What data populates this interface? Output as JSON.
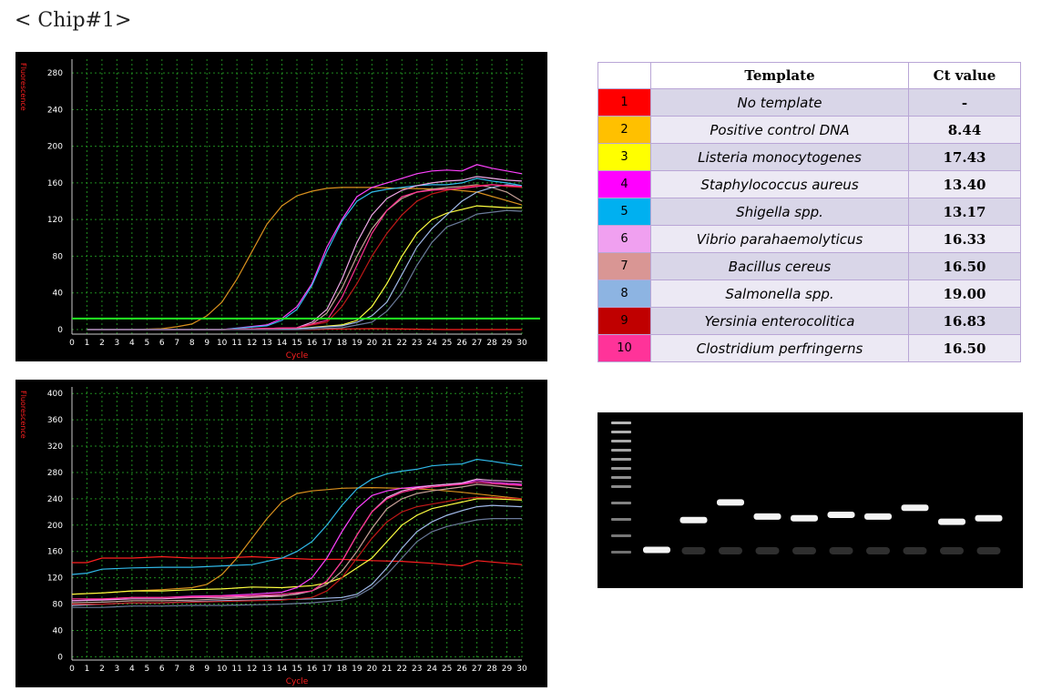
{
  "heading": "< Chip#1>",
  "chart_data": [
    {
      "type": "line",
      "ylabel": "Fluorescence",
      "xlabel": "Cycle",
      "xlim": [
        0,
        30
      ],
      "ylim": [
        -5,
        295
      ],
      "yticks": [
        0,
        40,
        80,
        120,
        160,
        200,
        240,
        280
      ],
      "xticks": [
        0,
        1,
        2,
        3,
        4,
        5,
        6,
        7,
        8,
        9,
        10,
        11,
        12,
        13,
        14,
        15,
        16,
        17,
        18,
        19,
        20,
        21,
        22,
        23,
        24,
        25,
        26,
        27,
        28,
        29,
        30
      ],
      "grid": true,
      "threshold": 12,
      "threshold_color": "#22ee22",
      "series": [
        {
          "color": "#ff2020",
          "x": [
            1,
            5,
            10,
            15,
            20,
            25,
            30
          ],
          "y": [
            0,
            0,
            0,
            0,
            1,
            0,
            0
          ]
        },
        {
          "color": "#d9901e",
          "x": [
            1,
            4,
            6,
            7,
            8,
            9,
            10,
            11,
            12,
            13,
            14,
            15,
            16,
            17,
            18,
            20,
            22,
            25,
            27,
            30
          ],
          "y": [
            0,
            0,
            1,
            3,
            6,
            15,
            30,
            55,
            85,
            115,
            135,
            146,
            151,
            154,
            155,
            155,
            154,
            153,
            150,
            136
          ]
        },
        {
          "color": "#ffff40",
          "x": [
            1,
            10,
            15,
            18,
            19,
            20,
            21,
            22,
            23,
            24,
            25,
            26,
            27,
            28,
            29,
            30
          ],
          "y": [
            0,
            0,
            1,
            5,
            10,
            25,
            50,
            80,
            105,
            120,
            127,
            131,
            135,
            134,
            133,
            133
          ]
        },
        {
          "color": "#ff40ff",
          "x": [
            1,
            10,
            13,
            14,
            15,
            16,
            17,
            18,
            19,
            20,
            21,
            22,
            23,
            24,
            25,
            26,
            27,
            28,
            29,
            30
          ],
          "y": [
            0,
            0,
            5,
            12,
            25,
            50,
            90,
            120,
            145,
            155,
            160,
            165,
            170,
            173,
            174,
            173,
            180,
            176,
            173,
            170
          ]
        },
        {
          "color": "#30b8e8",
          "x": [
            1,
            10,
            13,
            14,
            15,
            16,
            17,
            18,
            19,
            20,
            21,
            22,
            23,
            24,
            25,
            26,
            27,
            28,
            29,
            30
          ],
          "y": [
            0,
            0,
            4,
            10,
            22,
            48,
            85,
            118,
            140,
            150,
            153,
            155,
            157,
            158,
            158,
            160,
            165,
            162,
            160,
            157
          ]
        },
        {
          "color": "#f0a8e8",
          "x": [
            1,
            10,
            15,
            16,
            17,
            18,
            19,
            20,
            21,
            22,
            23,
            24,
            25,
            26,
            27,
            28,
            29,
            30
          ],
          "y": [
            0,
            0,
            2,
            8,
            22,
            55,
            95,
            125,
            143,
            152,
            157,
            160,
            162,
            163,
            167,
            165,
            163,
            162
          ]
        },
        {
          "color": "#c8a098",
          "x": [
            1,
            10,
            15,
            16,
            17,
            18,
            19,
            20,
            21,
            22,
            23,
            24,
            25,
            26,
            27,
            28,
            29,
            30
          ],
          "y": [
            0,
            0,
            2,
            6,
            18,
            45,
            80,
            110,
            130,
            143,
            150,
            153,
            155,
            156,
            158,
            155,
            150,
            140
          ]
        },
        {
          "color": "#a0b8e8",
          "x": [
            1,
            10,
            15,
            18,
            19,
            20,
            21,
            22,
            23,
            24,
            25,
            26,
            27,
            28,
            29,
            30
          ],
          "y": [
            0,
            0,
            1,
            4,
            8,
            15,
            30,
            60,
            90,
            110,
            125,
            140,
            150,
            155,
            158,
            156
          ]
        },
        {
          "color": "#c01818",
          "x": [
            1,
            10,
            15,
            17,
            18,
            19,
            20,
            21,
            22,
            23,
            24,
            25,
            26,
            27,
            28,
            29,
            30
          ],
          "y": [
            0,
            0,
            2,
            8,
            25,
            50,
            80,
            105,
            125,
            140,
            148,
            152,
            155,
            157,
            158,
            156,
            155
          ]
        },
        {
          "color": "#ff3090",
          "x": [
            1,
            10,
            15,
            17,
            18,
            19,
            20,
            21,
            22,
            23,
            24,
            25,
            26,
            27,
            28,
            29,
            30
          ],
          "y": [
            0,
            0,
            2,
            10,
            35,
            70,
            105,
            130,
            145,
            150,
            152,
            153,
            154,
            156,
            158,
            157,
            156
          ]
        },
        {
          "color": "#6a7a9a",
          "x": [
            1,
            10,
            15,
            18,
            20,
            21,
            22,
            23,
            24,
            25,
            26,
            27,
            28,
            29,
            30
          ],
          "y": [
            0,
            0,
            0,
            2,
            8,
            20,
            40,
            70,
            95,
            112,
            118,
            126,
            128,
            130,
            129
          ]
        }
      ]
    },
    {
      "type": "line",
      "ylabel": "Fluorescence",
      "xlabel": "Cycle",
      "xlim": [
        0,
        30
      ],
      "ylim": [
        -5,
        410
      ],
      "yticks": [
        0,
        40,
        80,
        120,
        160,
        200,
        240,
        280,
        320,
        360,
        400
      ],
      "xticks": [
        0,
        1,
        2,
        3,
        4,
        5,
        6,
        7,
        8,
        9,
        10,
        11,
        12,
        13,
        14,
        15,
        16,
        17,
        18,
        19,
        20,
        21,
        22,
        23,
        24,
        25,
        26,
        27,
        28,
        29,
        30
      ],
      "grid": true,
      "series": [
        {
          "color": "#ff2020",
          "x": [
            0,
            1,
            2,
            4,
            6,
            8,
            10,
            12,
            14,
            16,
            18,
            20,
            22,
            24,
            25,
            26,
            27,
            28,
            30
          ],
          "y": [
            143,
            143,
            150,
            150,
            152,
            150,
            150,
            152,
            150,
            148,
            148,
            146,
            145,
            142,
            140,
            138,
            146,
            144,
            140
          ]
        },
        {
          "color": "#d9901e",
          "x": [
            0,
            2,
            4,
            6,
            8,
            9,
            10,
            11,
            12,
            13,
            14,
            15,
            16,
            17,
            18,
            20,
            22,
            24,
            26,
            28,
            30
          ],
          "y": [
            95,
            97,
            100,
            102,
            105,
            110,
            125,
            150,
            180,
            210,
            235,
            248,
            252,
            254,
            256,
            257,
            256,
            254,
            250,
            245,
            240
          ]
        },
        {
          "color": "#ffff40",
          "x": [
            0,
            2,
            4,
            6,
            8,
            10,
            12,
            14,
            16,
            17,
            18,
            19,
            20,
            21,
            22,
            23,
            24,
            25,
            26,
            27,
            28,
            30
          ],
          "y": [
            95,
            97,
            100,
            100,
            102,
            103,
            106,
            105,
            108,
            112,
            120,
            135,
            150,
            175,
            200,
            215,
            225,
            230,
            235,
            240,
            240,
            238
          ]
        },
        {
          "color": "#ff40ff",
          "x": [
            0,
            2,
            4,
            6,
            8,
            10,
            12,
            14,
            15,
            16,
            17,
            18,
            19,
            20,
            21,
            22,
            23,
            24,
            25,
            26,
            27,
            28,
            30
          ],
          "y": [
            85,
            87,
            90,
            90,
            92,
            93,
            95,
            98,
            105,
            120,
            150,
            190,
            225,
            245,
            252,
            256,
            258,
            260,
            262,
            263,
            268,
            265,
            262
          ]
        },
        {
          "color": "#30b8e8",
          "x": [
            0,
            1,
            2,
            4,
            6,
            8,
            10,
            12,
            13,
            14,
            15,
            16,
            17,
            18,
            19,
            20,
            21,
            22,
            23,
            24,
            25,
            26,
            27,
            28,
            30
          ],
          "y": [
            125,
            127,
            133,
            135,
            136,
            136,
            138,
            140,
            145,
            150,
            160,
            175,
            200,
            230,
            255,
            270,
            278,
            282,
            285,
            290,
            292,
            293,
            300,
            297,
            290
          ]
        },
        {
          "color": "#f0a8e8",
          "x": [
            0,
            2,
            4,
            6,
            8,
            10,
            12,
            14,
            15,
            16,
            17,
            18,
            19,
            20,
            21,
            22,
            23,
            24,
            25,
            26,
            27,
            28,
            30
          ],
          "y": [
            85,
            86,
            88,
            88,
            90,
            90,
            92,
            93,
            95,
            100,
            115,
            145,
            185,
            220,
            242,
            252,
            257,
            260,
            262,
            264,
            270,
            268,
            266
          ]
        },
        {
          "color": "#c8a098",
          "x": [
            0,
            2,
            4,
            6,
            8,
            10,
            12,
            14,
            16,
            17,
            18,
            19,
            20,
            21,
            22,
            23,
            24,
            25,
            26,
            27,
            28,
            30
          ],
          "y": [
            82,
            83,
            85,
            85,
            86,
            88,
            90,
            92,
            100,
            110,
            130,
            160,
            195,
            225,
            240,
            248,
            252,
            255,
            258,
            262,
            260,
            255
          ]
        },
        {
          "color": "#a0b8e8",
          "x": [
            0,
            2,
            4,
            6,
            8,
            10,
            12,
            14,
            16,
            18,
            19,
            20,
            21,
            22,
            23,
            24,
            25,
            26,
            27,
            28,
            30
          ],
          "y": [
            78,
            80,
            82,
            82,
            84,
            85,
            86,
            87,
            88,
            90,
            95,
            110,
            135,
            165,
            190,
            205,
            215,
            222,
            228,
            230,
            228
          ]
        },
        {
          "color": "#c01818",
          "x": [
            0,
            2,
            4,
            6,
            8,
            10,
            12,
            14,
            16,
            17,
            18,
            19,
            20,
            21,
            22,
            23,
            24,
            25,
            26,
            27,
            28,
            30
          ],
          "y": [
            80,
            80,
            82,
            82,
            83,
            84,
            85,
            86,
            90,
            100,
            120,
            150,
            180,
            205,
            220,
            228,
            232,
            236,
            240,
            242,
            242,
            240
          ]
        },
        {
          "color": "#ff3090",
          "x": [
            0,
            2,
            4,
            6,
            8,
            10,
            12,
            14,
            16,
            17,
            18,
            19,
            20,
            21,
            22,
            23,
            24,
            25,
            26,
            27,
            28,
            30
          ],
          "y": [
            88,
            88,
            90,
            90,
            91,
            92,
            93,
            95,
            100,
            115,
            145,
            185,
            220,
            240,
            250,
            255,
            258,
            260,
            262,
            265,
            263,
            260
          ]
        },
        {
          "color": "#6a7a9a",
          "x": [
            0,
            2,
            4,
            6,
            8,
            10,
            12,
            14,
            16,
            18,
            19,
            20,
            21,
            22,
            23,
            24,
            25,
            26,
            27,
            28,
            30
          ],
          "y": [
            75,
            75,
            77,
            77,
            78,
            78,
            79,
            80,
            82,
            86,
            92,
            105,
            125,
            150,
            175,
            190,
            198,
            203,
            208,
            210,
            210
          ]
        }
      ]
    }
  ],
  "table": {
    "headers": [
      "",
      "Template",
      "Ct value"
    ],
    "rows": [
      {
        "num": "1",
        "template": "No template",
        "ct": "-",
        "color": "#ff0000"
      },
      {
        "num": "2",
        "template": "Positive control DNA",
        "ct": "8.44",
        "color": "#ffc000"
      },
      {
        "num": "3",
        "template": "Listeria monocytogenes",
        "ct": "17.43",
        "color": "#ffff00"
      },
      {
        "num": "4",
        "template": "Staphylococcus aureus",
        "ct": "13.40",
        "color": "#ff00ff"
      },
      {
        "num": "5",
        "template": "Shigella spp.",
        "ct": "13.17",
        "color": "#00b0f0"
      },
      {
        "num": "6",
        "template": "Vibrio parahaemolyticus",
        "ct": "16.33",
        "color": "#f0a0f0"
      },
      {
        "num": "7",
        "template": "Bacillus cereus",
        "ct": "16.50",
        "color": "#d99694"
      },
      {
        "num": "8",
        "template": "Salmonella spp.",
        "ct": "19.00",
        "color": "#8db4e2"
      },
      {
        "num": "9",
        "template": "Yersinia enterocolitica",
        "ct": "16.83",
        "color": "#c00000"
      },
      {
        "num": "10",
        "template": "Clostridium perfringerns",
        "ct": "16.50",
        "color": "#ff3399"
      }
    ]
  },
  "gel": {
    "ladder_band_count": 12,
    "lanes": [
      {
        "main_level": 0.78
      },
      {
        "main_level": 0.61
      },
      {
        "main_level": 0.51
      },
      {
        "main_level": 0.59
      },
      {
        "main_level": 0.6
      },
      {
        "main_level": 0.58
      },
      {
        "main_level": 0.59
      },
      {
        "main_level": 0.54
      },
      {
        "main_level": 0.62
      },
      {
        "main_level": 0.6
      }
    ]
  }
}
